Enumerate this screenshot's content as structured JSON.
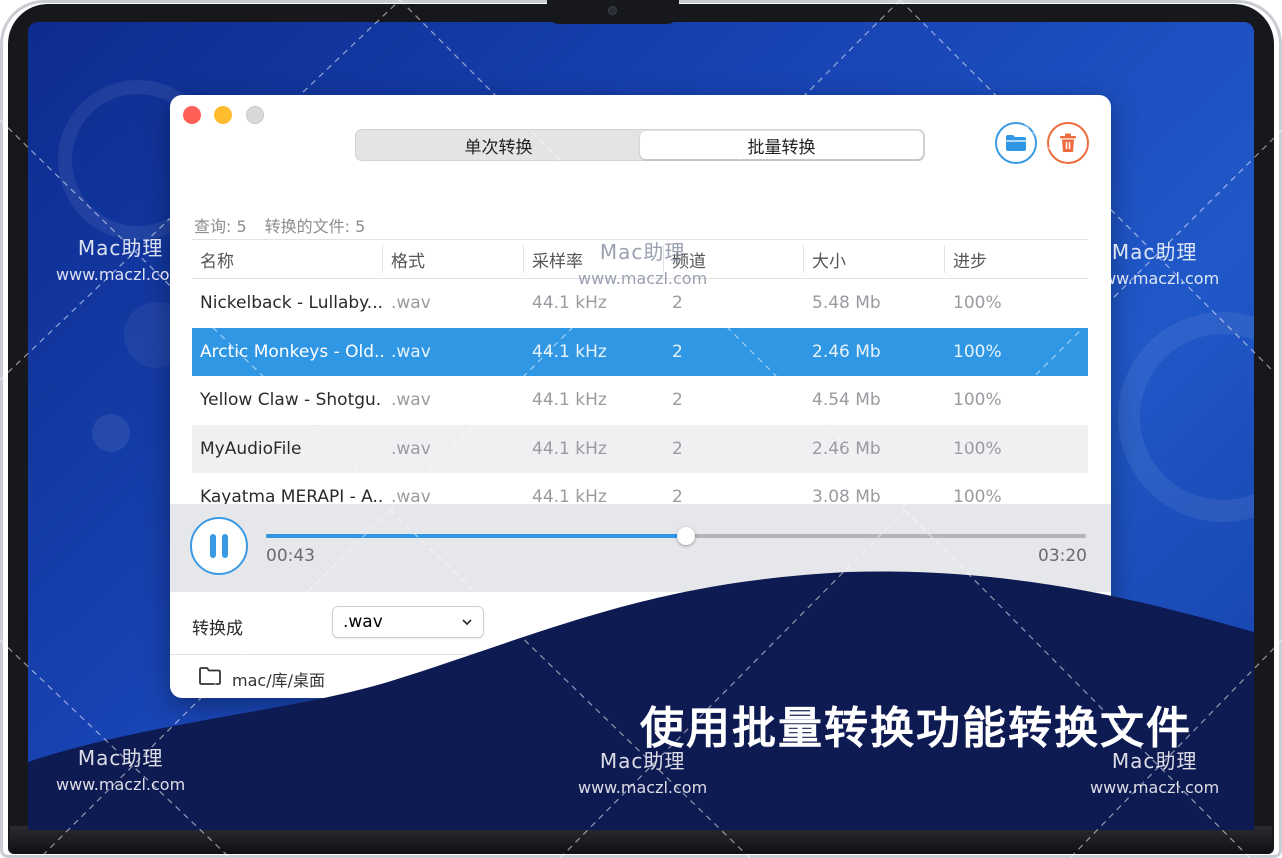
{
  "app": {
    "tabs": [
      {
        "label": "单次转换",
        "active": false
      },
      {
        "label": "批量转换",
        "active": true
      }
    ],
    "actions": {
      "open_icon": "folder-icon",
      "delete_icon": "trash-icon"
    },
    "stats": {
      "query": "查询: 5",
      "converted": "转换的文件: 5"
    },
    "columns": [
      "名称",
      "格式",
      "采样率",
      "频道",
      "大小",
      "进步"
    ],
    "rows": [
      {
        "name": "Nickelback - Lullaby....",
        "format": ".wav",
        "rate": "44.1 kHz",
        "channels": "2",
        "size": "5.48 Mb",
        "progress": "100%",
        "style": ""
      },
      {
        "name": "Arctic Monkeys - Old...",
        "format": ".wav",
        "rate": "44.1 kHz",
        "channels": "2",
        "size": "2.46 Mb",
        "progress": "100%",
        "style": "selected"
      },
      {
        "name": "Yellow Claw - Shotgu...",
        "format": ".wav",
        "rate": "44.1 kHz",
        "channels": "2",
        "size": "4.54 Mb",
        "progress": "100%",
        "style": ""
      },
      {
        "name": "MyAudioFile",
        "format": ".wav",
        "rate": "44.1 kHz",
        "channels": "2",
        "size": "2.46 Mb",
        "progress": "100%",
        "style": "alt"
      },
      {
        "name": "Kayatma MERAPI - A...",
        "format": ".wav",
        "rate": "44.1 kHz",
        "channels": "2",
        "size": "3.08 Mb",
        "progress": "100%",
        "style": ""
      }
    ],
    "player": {
      "elapsed": "00:43",
      "total": "03:20",
      "progress_fraction": 0.512,
      "pause_icon": "pause-icon"
    },
    "convert": {
      "label": "转换成",
      "selected_format": ".wav"
    },
    "output_path": "mac/库/桌面"
  },
  "headline": "使用批量转换功能转换文件",
  "watermark": {
    "brand": "Mac助理",
    "url": "www.maczl.com"
  },
  "colors": {
    "accent": "#2f97e4",
    "delete": "#ee6b3f",
    "navy": "#0e1a52",
    "screen_blue": "#1a47b8"
  }
}
